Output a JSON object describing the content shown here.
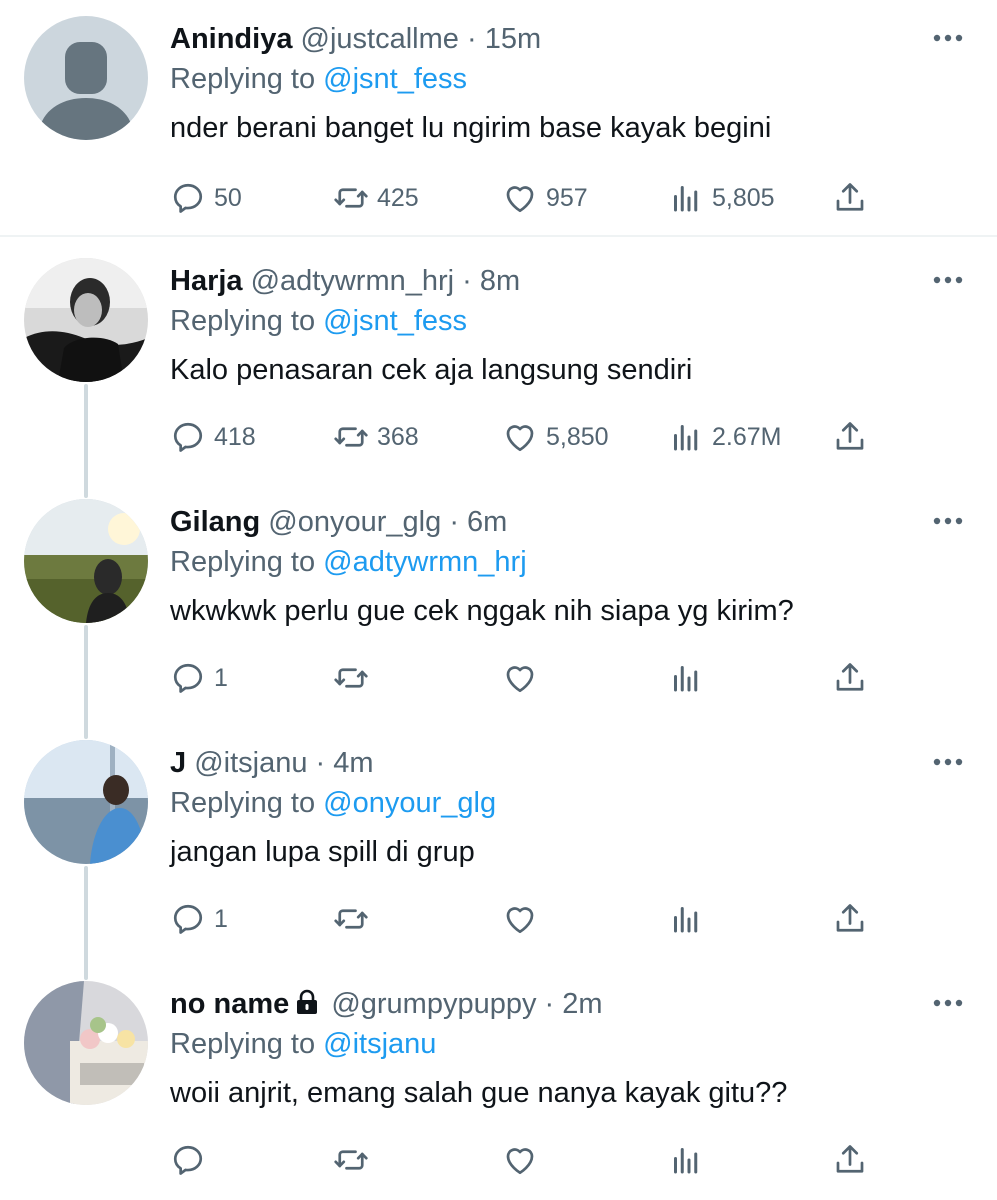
{
  "tweets": [
    {
      "name": "Anindiya",
      "handle": "@justcallme",
      "time": "15m",
      "replying_prefix": "Replying to ",
      "replying_to": "@jsnt_fess",
      "text": "nder berani banget lu ngirim base kayak begini",
      "replies": "50",
      "retweets": "425",
      "likes": "957",
      "views": "5,805",
      "locked": false
    },
    {
      "name": "Harja",
      "handle": "@adtywrmn_hrj",
      "time": "8m",
      "replying_prefix": "Replying to ",
      "replying_to": "@jsnt_fess",
      "text": "Kalo penasaran cek aja langsung sendiri",
      "replies": "418",
      "retweets": "368",
      "likes": "5,850",
      "views": "2.67M",
      "locked": false
    },
    {
      "name": "Gilang",
      "handle": "@onyour_glg",
      "time": "6m",
      "replying_prefix": "Replying to ",
      "replying_to": "@adtywrmn_hrj",
      "text": "wkwkwk perlu gue cek nggak nih siapa yg kirim?",
      "replies": "1",
      "retweets": "",
      "likes": "",
      "views": "",
      "locked": false
    },
    {
      "name": "J",
      "handle": "@itsjanu",
      "time": "4m",
      "replying_prefix": "Replying to ",
      "replying_to": "@onyour_glg",
      "text": "jangan lupa spill di grup",
      "replies": "1",
      "retweets": "",
      "likes": "",
      "views": "",
      "locked": false
    },
    {
      "name": "no name",
      "handle": "@grumpypuppy",
      "time": "2m",
      "replying_prefix": "Replying to ",
      "replying_to": "@itsjanu",
      "text": "woii anjrit, emang salah gue nanya kayak gitu??",
      "replies": "",
      "retweets": "",
      "likes": "",
      "views": "",
      "locked": true
    }
  ],
  "separator": "·",
  "icons": {
    "more": "more-horizontal-icon",
    "reply": "reply-icon",
    "retweet": "retweet-icon",
    "like": "heart-icon",
    "views": "views-icon",
    "share": "share-icon",
    "lock": "lock-icon"
  },
  "colors": {
    "text": "#0f1419",
    "secondary": "#536471",
    "link": "#1d9bf0",
    "thread_line": "#cfd9de",
    "divider": "#eff3f4"
  }
}
